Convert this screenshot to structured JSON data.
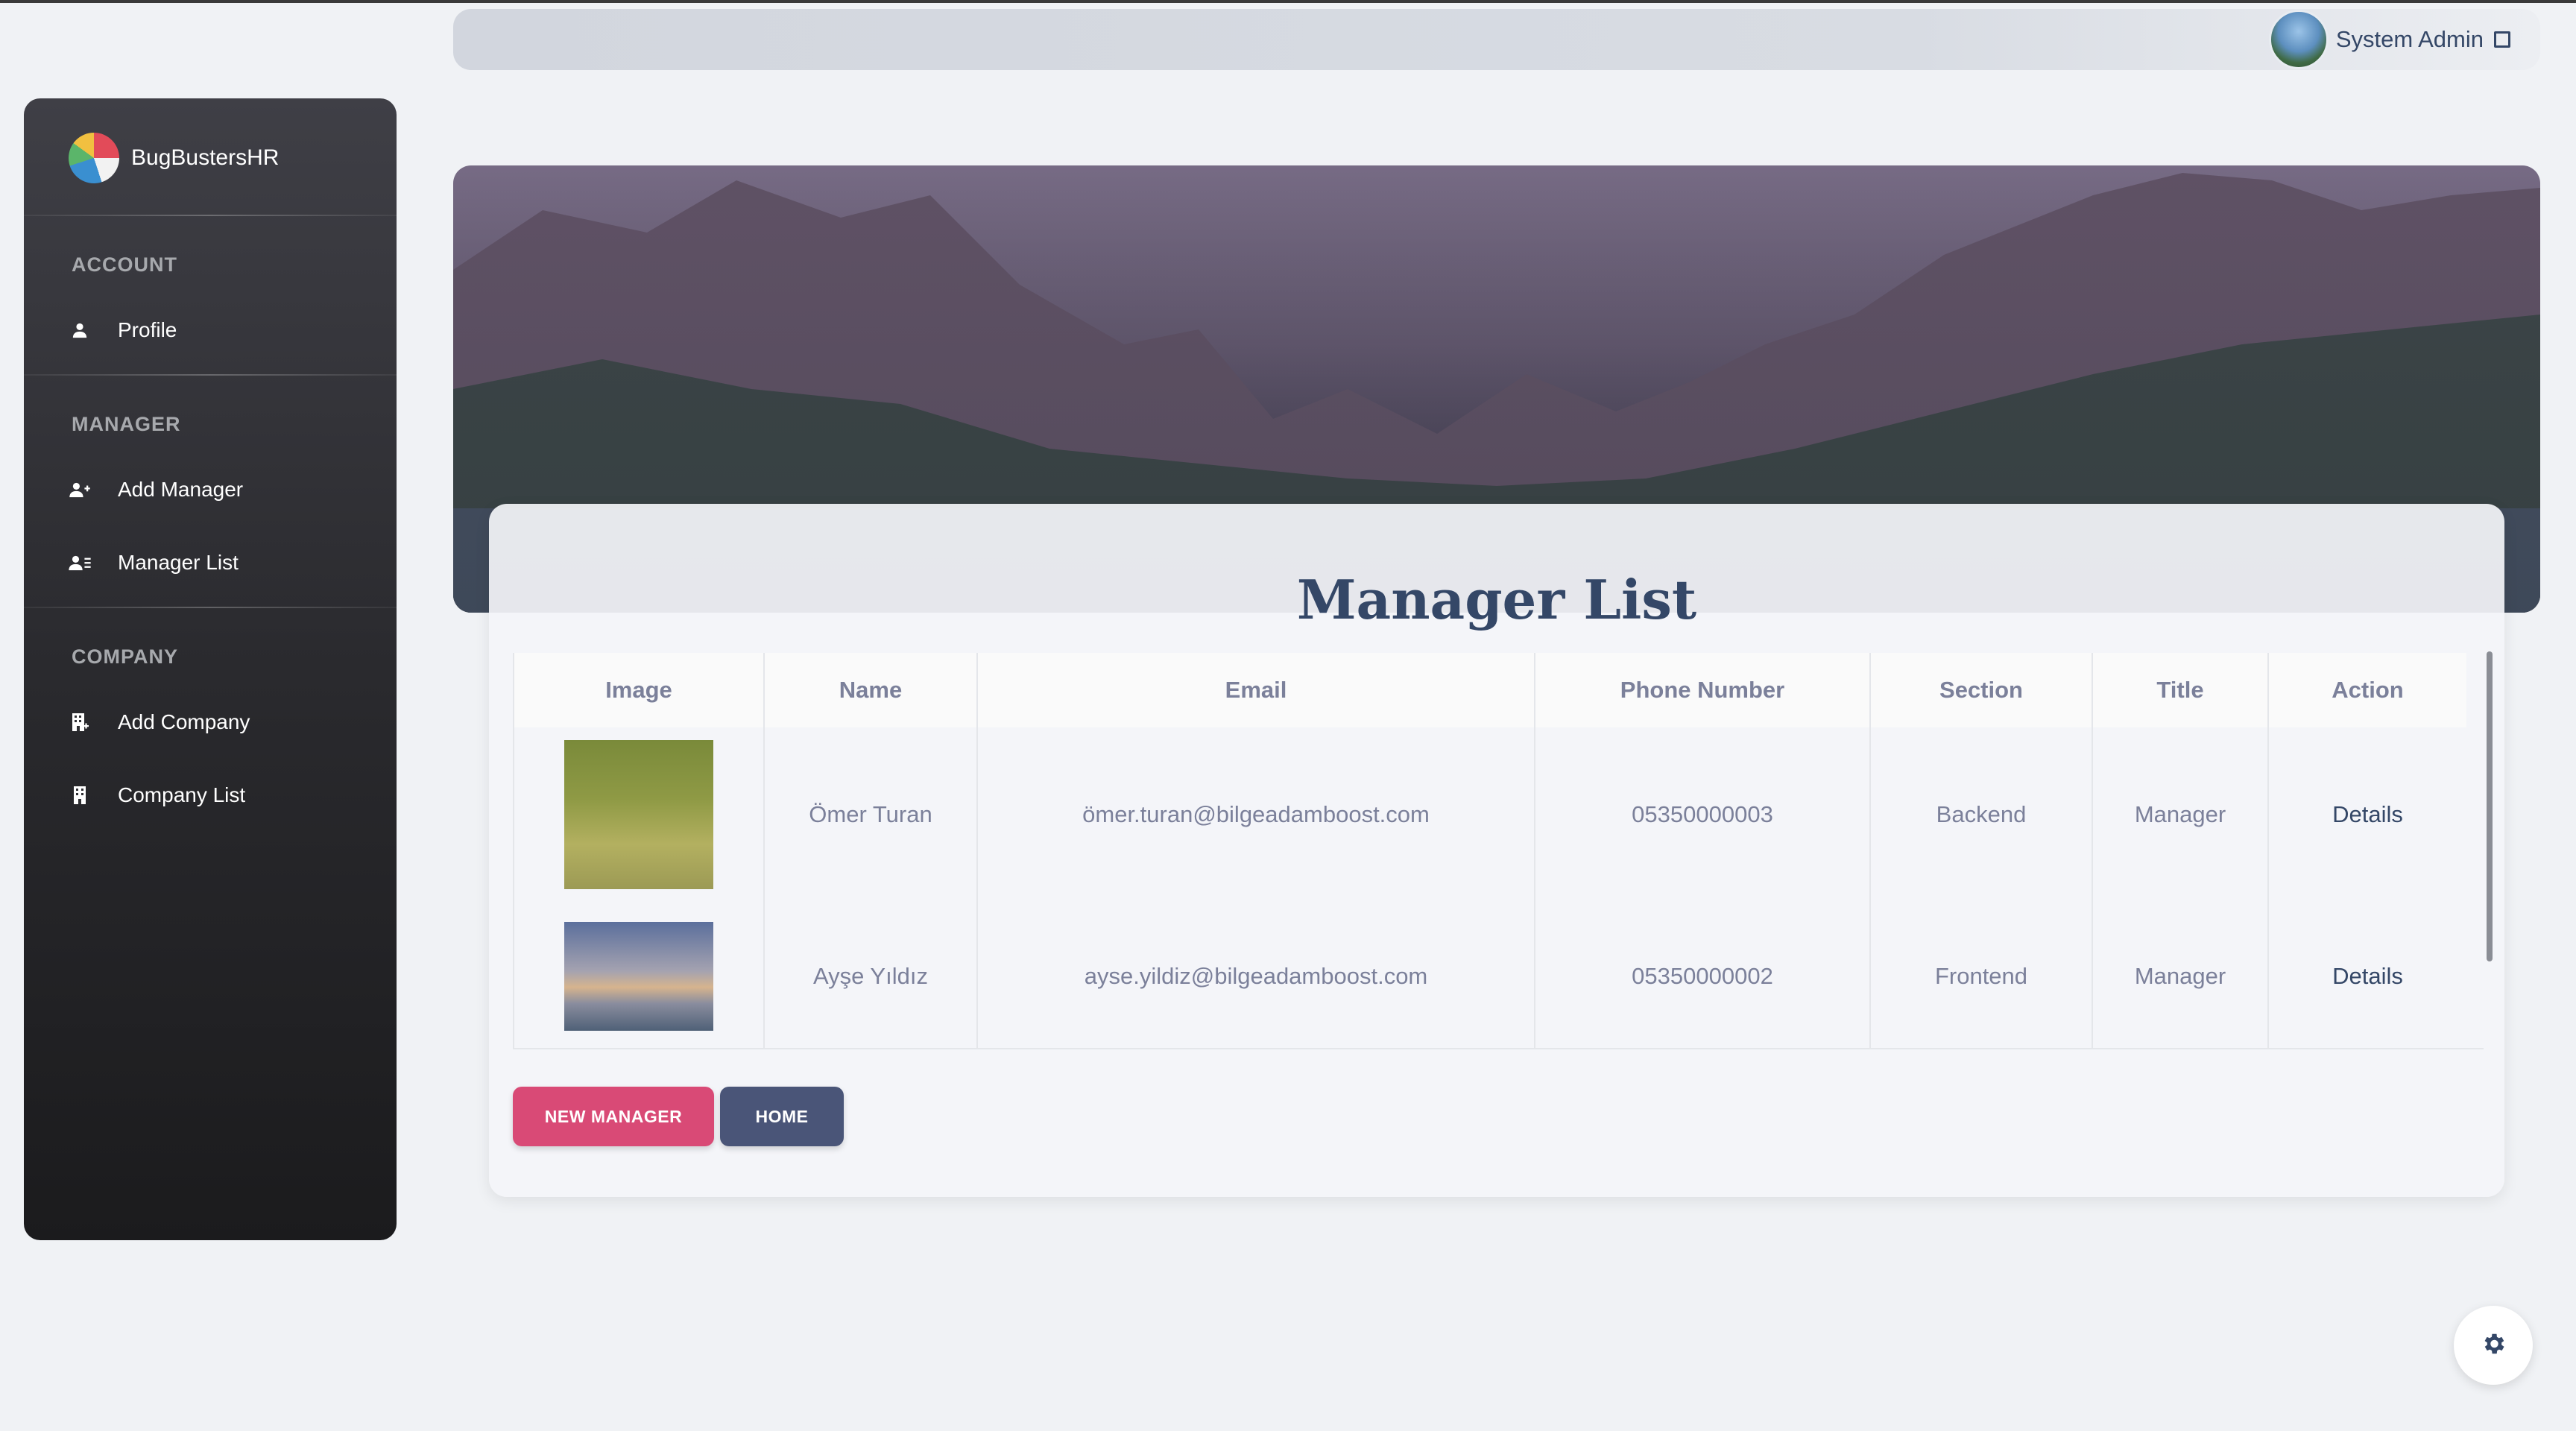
{
  "user": {
    "name": "System Admin"
  },
  "sidebar": {
    "brand": "BugBustersHR",
    "sections": [
      {
        "title": "ACCOUNT",
        "items": [
          {
            "label": "Profile",
            "icon": "person-icon"
          }
        ]
      },
      {
        "title": "MANAGER",
        "items": [
          {
            "label": "Add Manager",
            "icon": "person-add-icon"
          },
          {
            "label": "Manager List",
            "icon": "person-list-icon"
          }
        ]
      },
      {
        "title": "COMPANY",
        "items": [
          {
            "label": "Add Company",
            "icon": "building-add-icon"
          },
          {
            "label": "Company List",
            "icon": "building-icon"
          }
        ]
      }
    ]
  },
  "page": {
    "title": "Manager List"
  },
  "table": {
    "headers": [
      "Image",
      "Name",
      "Email",
      "Phone Number",
      "Section",
      "Title",
      "Action"
    ],
    "rows": [
      {
        "name": "Ömer Turan",
        "email": "ömer.turan@bilgeadamboost.com",
        "phone": "05350000003",
        "section": "Backend",
        "title": "Manager",
        "action": "Details"
      },
      {
        "name": "Ayşe Yıldız",
        "email": "ayse.yildiz@bilgeadamboost.com",
        "phone": "05350000002",
        "section": "Frontend",
        "title": "Manager",
        "action": "Details"
      }
    ]
  },
  "buttons": {
    "new_manager": "NEW MANAGER",
    "home": "HOME"
  },
  "colors": {
    "primary": "#d94a76",
    "secondary": "#4a5578",
    "text": "#344767"
  }
}
